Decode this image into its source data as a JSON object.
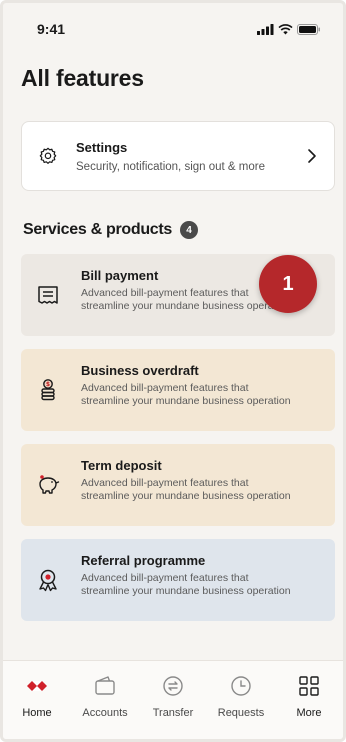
{
  "status": {
    "time": "9:41"
  },
  "page_title": "All features",
  "settings": {
    "title": "Settings",
    "subtitle": "Security, notification, sign out & more",
    "icon": "gear-icon"
  },
  "section": {
    "title": "Services & products",
    "count": "4"
  },
  "services": [
    {
      "name": "Bill payment",
      "line1": "Advanced bill-payment features that",
      "line2": "streamline your mundane business operation",
      "icon": "bill-icon"
    },
    {
      "name": "Business overdraft",
      "line1": "Advanced bill-payment features that",
      "line2": "streamline your mundane business operation",
      "icon": "coin-stack-icon"
    },
    {
      "name": "Term deposit",
      "line1": "Advanced bill-payment features that",
      "line2": "streamline your mundane business operation",
      "icon": "piggy-bank-icon"
    },
    {
      "name": "Referral programme",
      "line1": "Advanced bill-payment features that",
      "line2": "streamline your mundane business operation",
      "icon": "award-icon"
    }
  ],
  "onboarding_hint": "1",
  "tabs": [
    {
      "label": "Home",
      "icon": "hsbc-logo-icon"
    },
    {
      "label": "Accounts",
      "icon": "wallet-icon"
    },
    {
      "label": "Transfer",
      "icon": "transfer-icon"
    },
    {
      "label": "Requests",
      "icon": "clock-icon"
    },
    {
      "label": "More",
      "icon": "grid-icon"
    }
  ],
  "colors": {
    "brand": "#d0202a",
    "hint": "#b5282b"
  }
}
